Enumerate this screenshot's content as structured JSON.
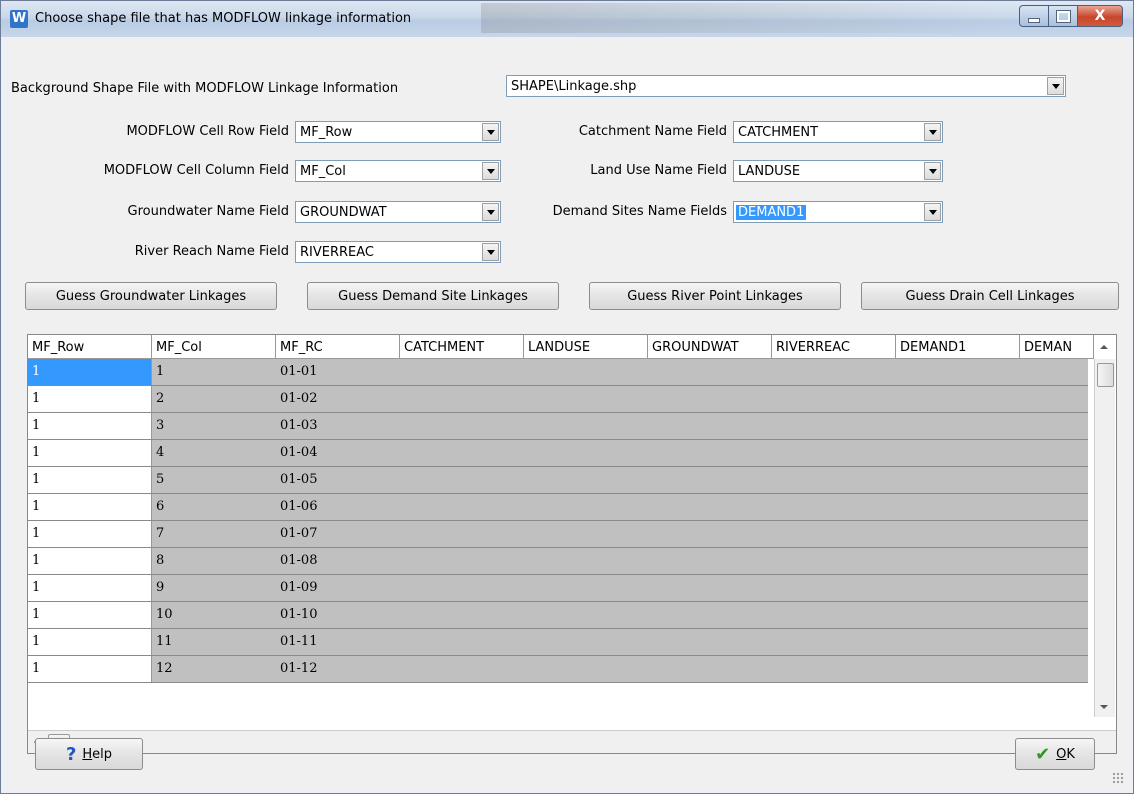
{
  "window": {
    "title": "Choose shape file that has MODFLOW linkage information",
    "icon_letter": "W",
    "close_glyph": "X"
  },
  "background_shape": {
    "label": "Background Shape File with MODFLOW Linkage Information",
    "value": "SHAPE\\Linkage.shp"
  },
  "fields_left": [
    {
      "label": "MODFLOW Cell Row Field",
      "value": "MF_Row"
    },
    {
      "label": "MODFLOW Cell Column Field",
      "value": "MF_Col"
    },
    {
      "label": "Groundwater Name Field",
      "value": "GROUNDWAT"
    },
    {
      "label": "River Reach Name Field",
      "value": "RIVERREAC"
    }
  ],
  "fields_right": [
    {
      "label": "Catchment Name Field",
      "value": "CATCHMENT"
    },
    {
      "label": "Land Use Name Field",
      "value": "LANDUSE"
    },
    {
      "label": "Demand Sites Name Fields",
      "value": "DEMAND1",
      "selected": true
    }
  ],
  "guess_buttons": [
    "Guess Groundwater Linkages",
    "Guess Demand Site Linkages",
    "Guess River Point Linkages",
    "Guess Drain Cell Linkages"
  ],
  "table": {
    "columns": [
      "MF_Row",
      "MF_Col",
      "MF_RC",
      "CATCHMENT",
      "LANDUSE",
      "GROUNDWAT",
      "RIVERREAC",
      "DEMAND1",
      "DEMAN"
    ],
    "rows": [
      [
        "1",
        "1",
        "01-01"
      ],
      [
        "1",
        "2",
        "01-02"
      ],
      [
        "1",
        "3",
        "01-03"
      ],
      [
        "1",
        "4",
        "01-04"
      ],
      [
        "1",
        "5",
        "01-05"
      ],
      [
        "1",
        "6",
        "01-06"
      ],
      [
        "1",
        "7",
        "01-07"
      ],
      [
        "1",
        "8",
        "01-08"
      ],
      [
        "1",
        "9",
        "01-09"
      ],
      [
        "1",
        "10",
        "01-10"
      ],
      [
        "1",
        "11",
        "01-11"
      ],
      [
        "1",
        "12",
        "01-12"
      ]
    ]
  },
  "footer": {
    "help_label": "Help",
    "help_mnemonic": "H",
    "help_rest": "elp",
    "ok_mnemonic": "O",
    "ok_rest": "K"
  },
  "icons": {
    "help": "question-icon",
    "ok": "checkmark-icon"
  },
  "colors": {
    "selection": "#3399ff",
    "row_background": "#c0c0c0"
  }
}
